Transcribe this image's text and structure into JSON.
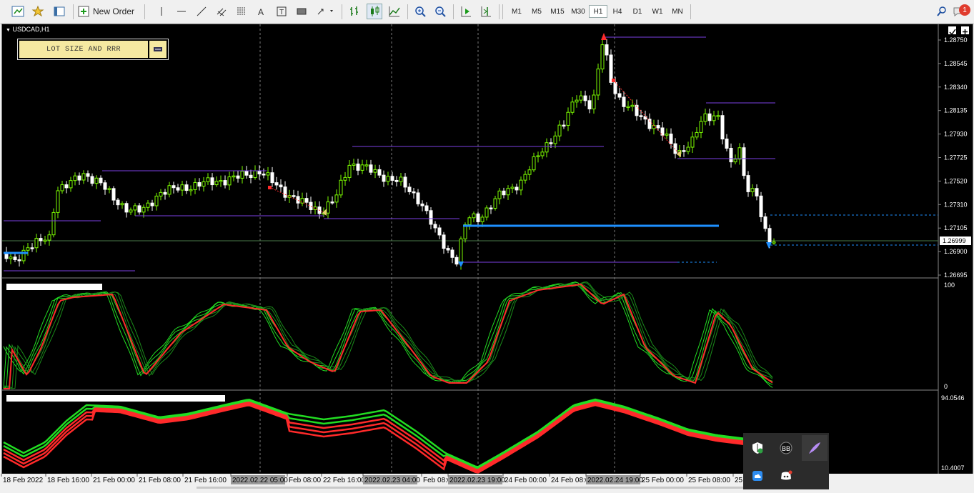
{
  "toolbar": {
    "new_order_label": "New Order",
    "timeframes": [
      "M1",
      "M5",
      "M15",
      "M30",
      "H1",
      "H4",
      "D1",
      "W1",
      "MN"
    ],
    "active_timeframe": "H1",
    "notification_count": "1"
  },
  "chart": {
    "symbol": "USDCAD,H1",
    "current_price": "1.26999",
    "price_labels": [
      "1.28750",
      "1.28545",
      "1.28340",
      "1.28135",
      "1.27930",
      "1.27725",
      "1.27520",
      "1.27310",
      "1.27105",
      "1.26900",
      "1.26695"
    ],
    "osc1_labels": [
      "100",
      "0"
    ],
    "osc2_labels": [
      "94.0546",
      "10.4007"
    ],
    "time_labels": [
      "18 Feb 2022",
      "18 Feb 16:00",
      "21 Feb 00:00",
      "21 Feb 08:00",
      "21 Feb 16:00",
      "2022.02.22 05:00",
      "Feb 08:00",
      "22 Feb 16:00",
      "2022.02.23 04:00",
      "Feb 08:00",
      "2022.02.23 19:00",
      "24 Feb 00:00",
      "24 Feb 08:00",
      "2022.02.24 19:00",
      "25 Feb 00:00",
      "25 Feb 08:00",
      "25"
    ],
    "colors": {
      "bull": "#7cfc00",
      "bear": "#ffffff",
      "up_line": "#22dd22",
      "down_line": "#ff2a2a",
      "level": "#7b3fe4",
      "blue": "#1e90ff"
    }
  },
  "lot_panel": {
    "title": "LOT SIZE AND RRR",
    "button_icon": "calculator-icon"
  },
  "tray": {
    "icons": [
      "shield-icon",
      "bb-icon",
      "feather-icon",
      "cloud-icon",
      "discord-icon"
    ]
  }
}
